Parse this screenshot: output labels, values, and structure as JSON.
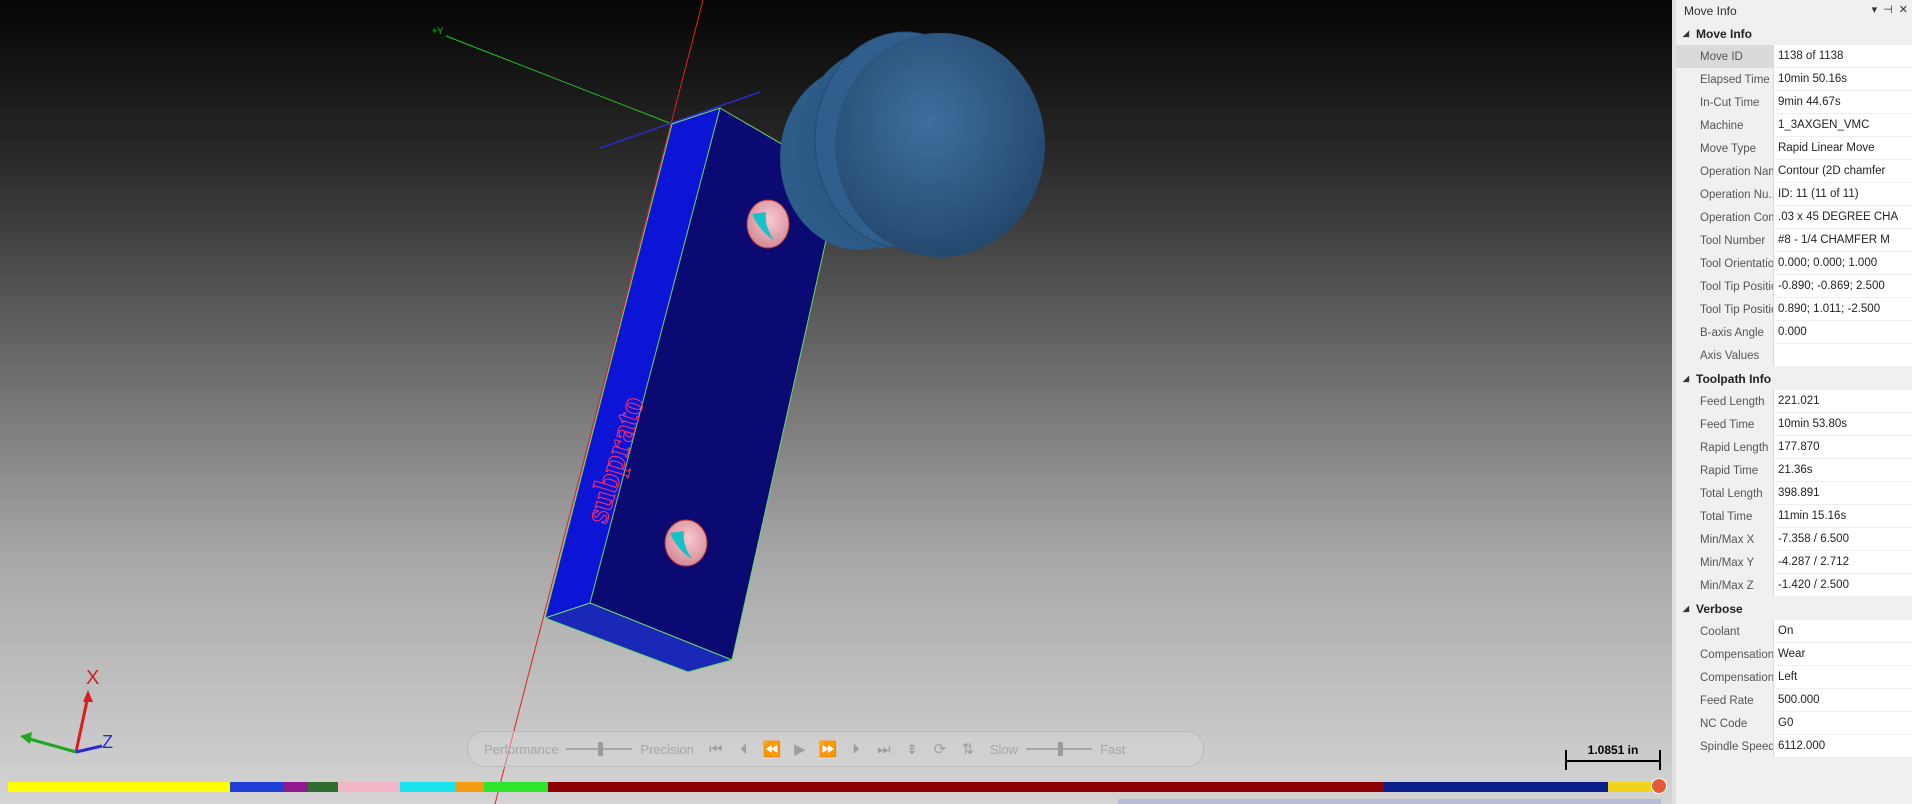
{
  "viewport": {
    "axis_y_label": "+Y",
    "triad": {
      "x_label": "X",
      "z_label": "Z"
    },
    "scale_label": "1.0851 in"
  },
  "playback": {
    "performance_label": "Performance",
    "precision_label": "Precision",
    "slow_label": "Slow",
    "fast_label": "Fast"
  },
  "timeline_colors": [
    "#ffff00",
    "#1f3fd6",
    "#8e1a8e",
    "#2f6e2f",
    "#f3b6c6",
    "#19e3ef",
    "#f39c12",
    "#2ce62c",
    "#8b0000",
    "#0a1f8a",
    "#f2d31b"
  ],
  "panel": {
    "title": "Move Info",
    "sections": [
      {
        "title": "Move Info",
        "rows": [
          {
            "name": "Move ID",
            "value": "1138 of 1138"
          },
          {
            "name": "Elapsed Time",
            "value": "10min 50.16s"
          },
          {
            "name": "In-Cut Time",
            "value": "9min 44.67s"
          },
          {
            "name": "Machine",
            "value": "1_3AXGEN_VMC"
          },
          {
            "name": "Move Type",
            "value": "Rapid Linear Move"
          },
          {
            "name": "Operation Name",
            "value": "Contour (2D chamfer"
          },
          {
            "name": "Operation Nu...",
            "value": "ID: 11 (11 of 11)"
          },
          {
            "name": "Operation Com...",
            "value": ".03 x 45 DEGREE CHA"
          },
          {
            "name": "Tool Number",
            "value": "#8 -  1/4 CHAMFER M"
          },
          {
            "name": "Tool Orientation",
            "value": "0.000; 0.000; 1.000"
          },
          {
            "name": "Tool Tip Positio...",
            "value": "-0.890; -0.869; 2.500"
          },
          {
            "name": "Tool Tip Positio...",
            "value": "0.890; 1.011; -2.500"
          },
          {
            "name": "B-axis Angle",
            "value": "0.000"
          },
          {
            "name": "Axis Values",
            "value": ""
          }
        ]
      },
      {
        "title": "Toolpath Info",
        "rows": [
          {
            "name": "Feed Length",
            "value": "221.021"
          },
          {
            "name": "Feed Time",
            "value": "10min 53.80s"
          },
          {
            "name": "Rapid Length",
            "value": "177.870"
          },
          {
            "name": "Rapid Time",
            "value": "21.36s"
          },
          {
            "name": "Total Length",
            "value": "398.891"
          },
          {
            "name": "Total Time",
            "value": "11min 15.16s"
          },
          {
            "name": "Min/Max X",
            "value": "-7.358 / 6.500"
          },
          {
            "name": "Min/Max Y",
            "value": "-4.287 / 2.712"
          },
          {
            "name": "Min/Max Z",
            "value": "-1.420 / 2.500"
          }
        ]
      },
      {
        "title": "Verbose",
        "rows": [
          {
            "name": "Coolant",
            "value": "On"
          },
          {
            "name": "Compensation...",
            "value": "Wear"
          },
          {
            "name": "Compensation...",
            "value": "Left"
          },
          {
            "name": "Feed Rate",
            "value": "500.000"
          },
          {
            "name": "NC Code",
            "value": "G0"
          },
          {
            "name": "Spindle Speed",
            "value": "6112.000"
          }
        ]
      }
    ]
  }
}
